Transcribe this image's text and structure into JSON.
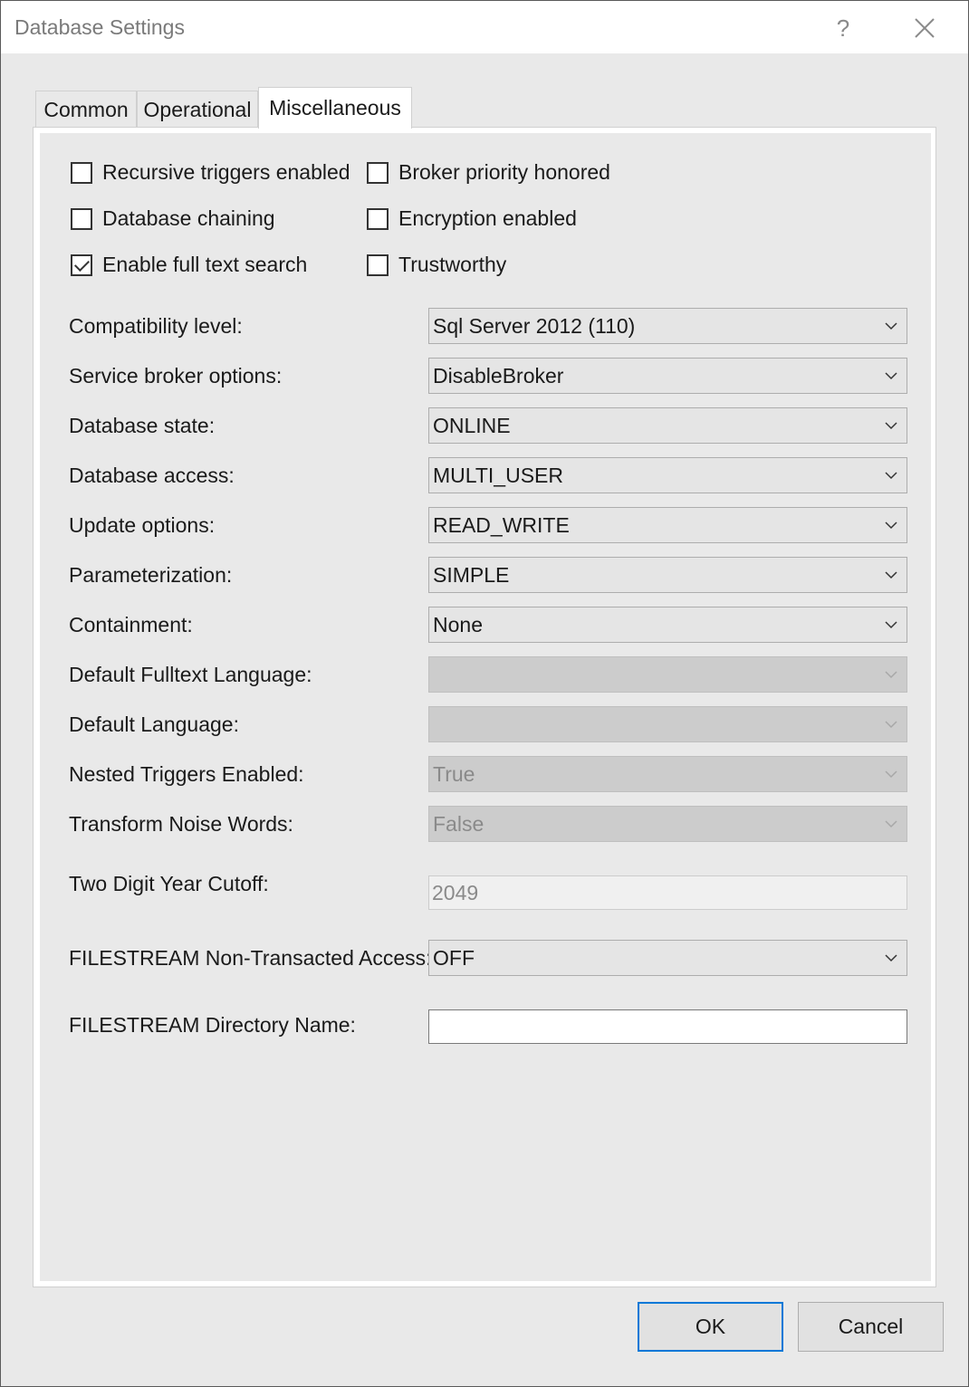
{
  "window": {
    "title": "Database Settings",
    "help_glyph": "?"
  },
  "tabs": [
    {
      "label": "Common"
    },
    {
      "label": "Operational"
    },
    {
      "label": "Miscellaneous",
      "selected": true
    }
  ],
  "checkboxes": [
    {
      "label": "Recursive triggers enabled",
      "checked": false
    },
    {
      "label": "Broker priority honored",
      "checked": false
    },
    {
      "label": "Database chaining",
      "checked": false
    },
    {
      "label": "Encryption enabled",
      "checked": false
    },
    {
      "label": "Enable full text search",
      "checked": true
    },
    {
      "label": "Trustworthy",
      "checked": false
    }
  ],
  "fields": [
    {
      "label": "Compatibility level:",
      "value": "Sql Server 2012 (110)",
      "type": "dropdown",
      "enabled": true
    },
    {
      "label": "Service broker options:",
      "value": "DisableBroker",
      "type": "dropdown",
      "enabled": true
    },
    {
      "label": "Database state:",
      "value": "ONLINE",
      "type": "dropdown",
      "enabled": true
    },
    {
      "label": "Database access:",
      "value": "MULTI_USER",
      "type": "dropdown",
      "enabled": true
    },
    {
      "label": "Update options:",
      "value": "READ_WRITE",
      "type": "dropdown",
      "enabled": true
    },
    {
      "label": "Parameterization:",
      "value": "SIMPLE",
      "type": "dropdown",
      "enabled": true
    },
    {
      "label": "Containment:",
      "value": "None",
      "type": "dropdown",
      "enabled": true
    },
    {
      "label": "Default Fulltext Language:",
      "value": "",
      "type": "dropdown",
      "enabled": false
    },
    {
      "label": "Default Language:",
      "value": "",
      "type": "dropdown",
      "enabled": false
    },
    {
      "label": "Nested Triggers Enabled:",
      "value": "True",
      "type": "dropdown",
      "enabled": false
    },
    {
      "label": "Transform Noise Words:",
      "value": "False",
      "type": "dropdown",
      "enabled": false
    },
    {
      "label": "Two Digit Year Cutoff:",
      "value": "2049",
      "type": "text",
      "enabled": false
    },
    {
      "label": "FILESTREAM Non-Transacted Access:",
      "value": "OFF",
      "type": "dropdown",
      "enabled": true
    },
    {
      "label": "FILESTREAM Directory Name:",
      "value": "",
      "type": "text",
      "enabled": true
    }
  ],
  "buttons": {
    "ok": "OK",
    "cancel": "Cancel"
  },
  "colors": {
    "accent": "#0078d7",
    "panel_bg": "#e9e9e9",
    "disabled_field": "#cccccc"
  }
}
